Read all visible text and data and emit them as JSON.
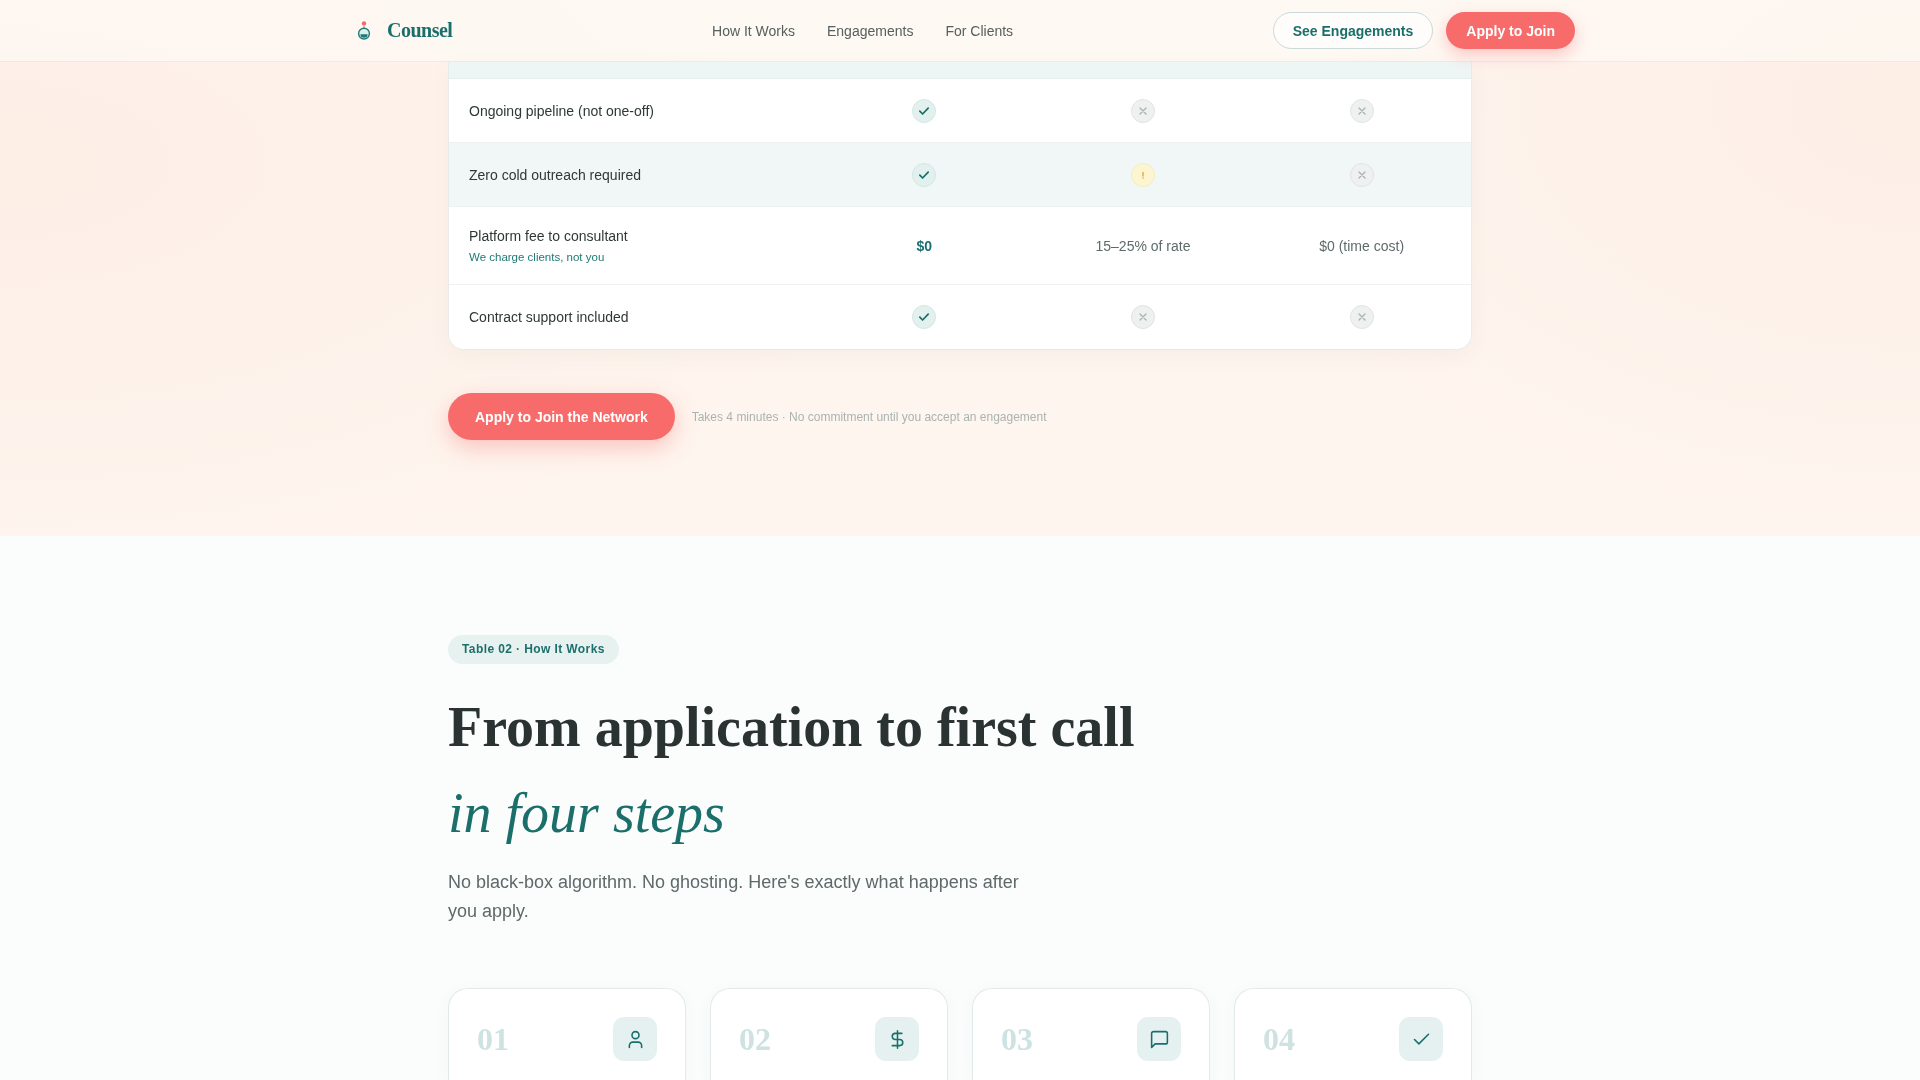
{
  "nav": {
    "brand": "Counsel",
    "links": [
      {
        "label": "How It Works"
      },
      {
        "label": "Engagements"
      },
      {
        "label": "For Clients"
      }
    ],
    "buttons": [
      {
        "label": "See Engagements",
        "kind": "outline"
      },
      {
        "label": "Apply to Join",
        "kind": "primary"
      }
    ]
  },
  "comparison": {
    "rows": [
      {
        "label": "Ongoing pipeline (not one-off)",
        "highlighted": false,
        "cells": [
          {
            "kind": "yes"
          },
          {
            "kind": "no"
          },
          {
            "kind": "no"
          }
        ]
      },
      {
        "label": "Zero cold outreach required",
        "highlighted": true,
        "cells": [
          {
            "kind": "yes"
          },
          {
            "kind": "partial"
          },
          {
            "kind": "no"
          }
        ]
      },
      {
        "label": "Platform fee to consultant",
        "note": "We charge clients, not you",
        "highlighted": false,
        "cells": [
          {
            "kind": "text",
            "text": "$0",
            "emphasis": true
          },
          {
            "kind": "text",
            "text": "15–25% of rate",
            "emphasis": false
          },
          {
            "kind": "text",
            "text": "$0 (time cost)",
            "emphasis": false
          }
        ]
      },
      {
        "label": "Contract support included",
        "highlighted": false,
        "cells": [
          {
            "kind": "yes"
          },
          {
            "kind": "no"
          },
          {
            "kind": "no"
          }
        ]
      }
    ]
  },
  "cta": {
    "button": "Apply to Join the Network",
    "note": "Takes 4 minutes · No commitment until you accept an engagement"
  },
  "how_it_works": {
    "badge": "Table 02 · How It Works",
    "title": "From application to first call",
    "title_accent": "in four steps",
    "intro": "No black-box algorithm. No ghosting. Here's exactly what happens after you apply.",
    "steps": [
      {
        "number": "01"
      },
      {
        "number": "02"
      },
      {
        "number": "03"
      },
      {
        "number": "04"
      }
    ]
  }
}
